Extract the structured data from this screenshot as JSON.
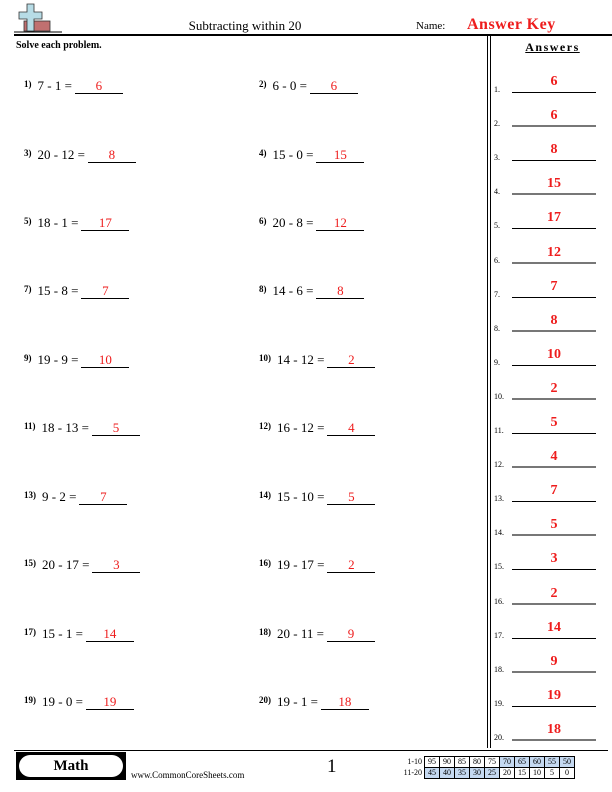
{
  "header": {
    "title": "Subtracting within 20",
    "name_label": "Name:",
    "name_value": "Answer Key"
  },
  "instructions": "Solve each problem.",
  "problems": [
    {
      "num": "1)",
      "expr": "7 - 1 =",
      "answer": "6"
    },
    {
      "num": "2)",
      "expr": "6 - 0 =",
      "answer": "6"
    },
    {
      "num": "3)",
      "expr": "20 - 12 =",
      "answer": "8"
    },
    {
      "num": "4)",
      "expr": "15 - 0 =",
      "answer": "15"
    },
    {
      "num": "5)",
      "expr": "18 - 1 =",
      "answer": "17"
    },
    {
      "num": "6)",
      "expr": "20 - 8 =",
      "answer": "12"
    },
    {
      "num": "7)",
      "expr": "15 - 8 =",
      "answer": "7"
    },
    {
      "num": "8)",
      "expr": "14 - 6 =",
      "answer": "8"
    },
    {
      "num": "9)",
      "expr": "19 - 9 =",
      "answer": "10"
    },
    {
      "num": "10)",
      "expr": "14 - 12 =",
      "answer": "2"
    },
    {
      "num": "11)",
      "expr": "18 - 13 =",
      "answer": "5"
    },
    {
      "num": "12)",
      "expr": "16 - 12 =",
      "answer": "4"
    },
    {
      "num": "13)",
      "expr": "9 - 2 =",
      "answer": "7"
    },
    {
      "num": "14)",
      "expr": "15 - 10 =",
      "answer": "5"
    },
    {
      "num": "15)",
      "expr": "20 - 17 =",
      "answer": "3"
    },
    {
      "num": "16)",
      "expr": "19 - 17 =",
      "answer": "2"
    },
    {
      "num": "17)",
      "expr": "15 - 1 =",
      "answer": "14"
    },
    {
      "num": "18)",
      "expr": "20 - 11 =",
      "answer": "9"
    },
    {
      "num": "19)",
      "expr": "19 - 0 =",
      "answer": "19"
    },
    {
      "num": "20)",
      "expr": "19 - 1 =",
      "answer": "18"
    }
  ],
  "answers": {
    "title": "Answers",
    "items": [
      {
        "idx": "1.",
        "val": "6"
      },
      {
        "idx": "2.",
        "val": "6"
      },
      {
        "idx": "3.",
        "val": "8"
      },
      {
        "idx": "4.",
        "val": "15"
      },
      {
        "idx": "5.",
        "val": "17"
      },
      {
        "idx": "6.",
        "val": "12"
      },
      {
        "idx": "7.",
        "val": "7"
      },
      {
        "idx": "8.",
        "val": "8"
      },
      {
        "idx": "9.",
        "val": "10"
      },
      {
        "idx": "10.",
        "val": "2"
      },
      {
        "idx": "11.",
        "val": "5"
      },
      {
        "idx": "12.",
        "val": "4"
      },
      {
        "idx": "13.",
        "val": "7"
      },
      {
        "idx": "14.",
        "val": "5"
      },
      {
        "idx": "15.",
        "val": "3"
      },
      {
        "idx": "16.",
        "val": "2"
      },
      {
        "idx": "17.",
        "val": "14"
      },
      {
        "idx": "18.",
        "val": "9"
      },
      {
        "idx": "19.",
        "val": "19"
      },
      {
        "idx": "20.",
        "val": "18"
      }
    ]
  },
  "footer": {
    "subject": "Math",
    "site": "www.CommonCoreSheets.com",
    "page": "1",
    "score_rows": [
      {
        "label": "1-10",
        "scores": [
          "95",
          "90",
          "85",
          "80",
          "75",
          "70",
          "65",
          "60",
          "55",
          "50"
        ],
        "highlight_from": 5
      },
      {
        "label": "11-20",
        "scores": [
          "45",
          "40",
          "35",
          "30",
          "25",
          "20",
          "15",
          "10",
          "5",
          "0"
        ],
        "highlight_until": 5
      }
    ]
  },
  "colors": {
    "answer_red": "#ee1c1c",
    "score_highlight": "#c5d9f1"
  }
}
